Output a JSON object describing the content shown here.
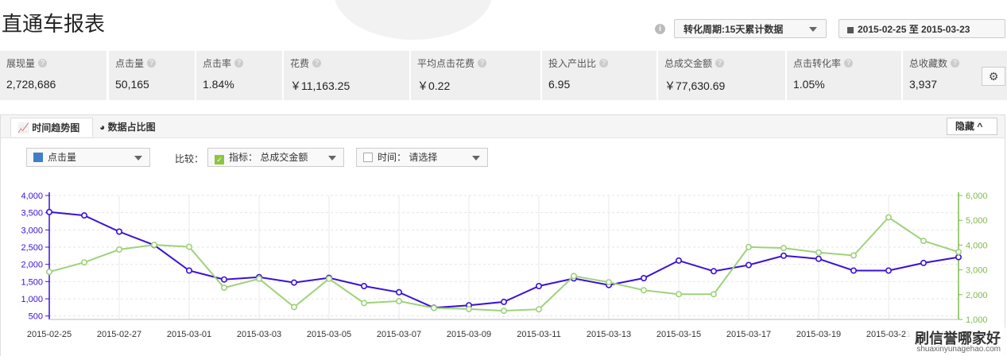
{
  "header": {
    "title": "直通车报表",
    "info_icon": "info-icon",
    "period_label": "转化周期:15天累计数据",
    "date_range": "2015-02-25 至 2015-03-23"
  },
  "metrics": [
    {
      "label": "展现量",
      "value": "2,728,686"
    },
    {
      "label": "点击量",
      "value": "50,165"
    },
    {
      "label": "点击率",
      "value": "1.84%"
    },
    {
      "label": "花费",
      "value": "￥11,163.25"
    },
    {
      "label": "平均点击花费",
      "value": "￥0.22"
    },
    {
      "label": "投入产出比",
      "value": "6.95"
    },
    {
      "label": "总成交金额",
      "value": "￥77,630.69"
    },
    {
      "label": "点击转化率",
      "value": "1.05%"
    },
    {
      "label": "总收藏数",
      "value": "3,937"
    }
  ],
  "toolbar": {
    "settings_icon": "gear-icon",
    "tab_trend": "时间趋势图",
    "tab_share": "数据占比图",
    "hide_label": "隐藏"
  },
  "filters": {
    "metric_select": "点击量",
    "compare_label": "比较：",
    "compare_select": "指标： 总成交金额",
    "time_select": "时间： 请选择"
  },
  "colors": {
    "series_clicks": "#3a10d8",
    "series_sales": "#9ed27a",
    "metric_bg": "#efefef"
  },
  "chart_data": {
    "type": "line",
    "x": [
      "2015-02-25",
      "2015-02-26",
      "2015-02-27",
      "2015-02-28",
      "2015-03-01",
      "2015-03-02",
      "2015-03-03",
      "2015-03-04",
      "2015-03-05",
      "2015-03-06",
      "2015-03-07",
      "2015-03-08",
      "2015-03-09",
      "2015-03-10",
      "2015-03-11",
      "2015-03-12",
      "2015-03-13",
      "2015-03-14",
      "2015-03-15",
      "2015-03-16",
      "2015-03-17",
      "2015-03-18",
      "2015-03-19",
      "2015-03-20",
      "2015-03-21",
      "2015-03-22",
      "2015-03-23"
    ],
    "x_tick_labels": [
      "2015-02-25",
      "2015-02-27",
      "2015-03-01",
      "2015-03-03",
      "2015-03-05",
      "2015-03-07",
      "2015-03-09",
      "2015-03-11",
      "2015-03-13",
      "2015-03-15",
      "2015-03-17",
      "2015-03-19",
      "2015-03-21",
      "2015-03-23"
    ],
    "y_left_ticks": [
      "4,000",
      "3,500",
      "3,000",
      "2,500",
      "2,000",
      "1,500",
      "1,000",
      "500"
    ],
    "y_right_ticks": [
      "6,000",
      "5,000",
      "4,000",
      "3,000",
      "2,000",
      "1,000"
    ],
    "ylim_left": [
      400,
      4000
    ],
    "ylim_right": [
      1000,
      6000
    ],
    "grid": true,
    "series": [
      {
        "name": "点击量",
        "axis": "left",
        "values": [
          3520,
          3420,
          2950,
          2560,
          1820,
          1560,
          1630,
          1470,
          1610,
          1370,
          1190,
          740,
          810,
          910,
          1370,
          1590,
          1400,
          1600,
          2110,
          1800,
          1980,
          2250,
          2160,
          1820,
          1820,
          2040,
          2210
        ]
      },
      {
        "name": "总成交金额",
        "axis": "right",
        "values": [
          2920,
          3300,
          3820,
          4010,
          3930,
          2280,
          2640,
          1500,
          2640,
          1660,
          1740,
          1460,
          1420,
          1350,
          1410,
          2750,
          2500,
          2180,
          2020,
          2020,
          3920,
          3880,
          3700,
          3580,
          5120,
          4170,
          3720
        ]
      }
    ]
  },
  "watermark": {
    "main": "刷信誉哪家好",
    "sub": "shuaxinyunagehao.com"
  }
}
